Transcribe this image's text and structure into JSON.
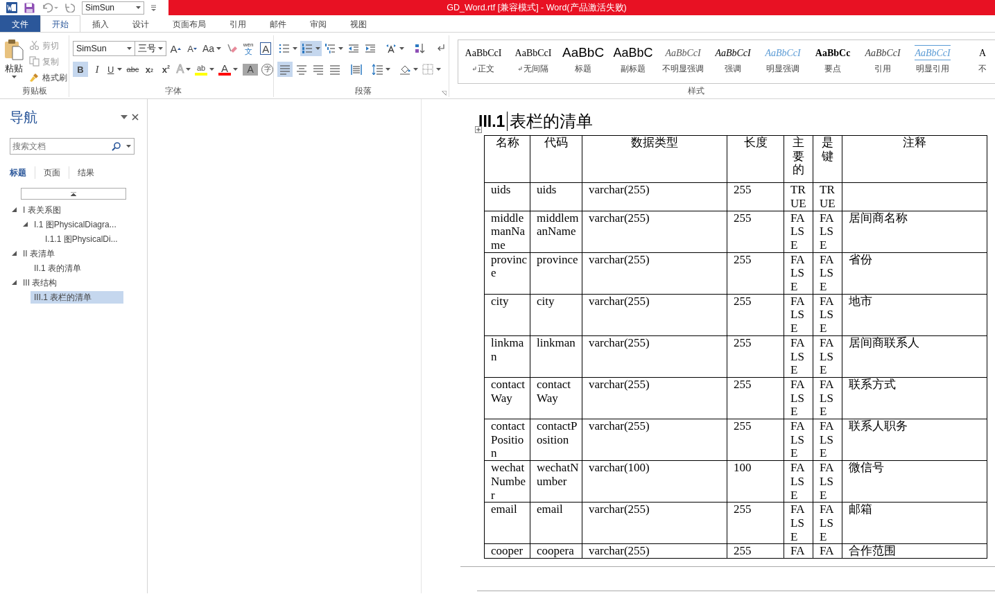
{
  "title_bar": {
    "font_box": "SimSun",
    "title": "GD_Word.rtf [兼容模式] - Word(产品激活失败)"
  },
  "tabs": [
    {
      "label": "文件",
      "kind": "file",
      "selected": false
    },
    {
      "label": "开始",
      "kind": "tab",
      "selected": true
    },
    {
      "label": "插入",
      "kind": "tab",
      "selected": false
    },
    {
      "label": "设计",
      "kind": "tab",
      "selected": false
    },
    {
      "label": "页面布局",
      "kind": "tab",
      "selected": false
    },
    {
      "label": "引用",
      "kind": "tab",
      "selected": false
    },
    {
      "label": "邮件",
      "kind": "tab",
      "selected": false
    },
    {
      "label": "审阅",
      "kind": "tab",
      "selected": false
    },
    {
      "label": "视图",
      "kind": "tab",
      "selected": false
    }
  ],
  "ribbon": {
    "clipboard": {
      "title": "剪贴板",
      "paste": "粘贴",
      "tools": [
        {
          "kind": "cut",
          "label": "剪切",
          "disabled": true
        },
        {
          "kind": "copy",
          "label": "复制",
          "disabled": true
        },
        {
          "kind": "painter",
          "label": "格式刷",
          "disabled": false
        }
      ]
    },
    "font": {
      "title": "字体",
      "name": "SimSun",
      "size": "三号",
      "row1": [
        {
          "kind": "grow",
          "label": "A"
        },
        {
          "kind": "shrink",
          "label": "A"
        },
        {
          "kind": "case",
          "label": "Aa"
        },
        {
          "kind": "clear"
        },
        {
          "kind": "pinyin",
          "label": "wén",
          "sub": "文"
        },
        {
          "kind": "border",
          "label": "A"
        }
      ],
      "row2": [
        {
          "kind": "bold",
          "label": "B",
          "selected": true
        },
        {
          "kind": "italic",
          "label": "I",
          "selected": false
        },
        {
          "kind": "underline",
          "label": "U",
          "selected": false
        },
        {
          "kind": "strike",
          "label": "abc",
          "selected": false
        },
        {
          "kind": "subscript",
          "label": "x",
          "sub": "2",
          "selected": false
        },
        {
          "kind": "superscript",
          "label": "x",
          "sub": "2",
          "selected": false
        },
        {
          "kind": "effects",
          "label": "A"
        },
        {
          "kind": "highlight",
          "label": "ab",
          "color": "#ffff00"
        },
        {
          "kind": "color",
          "label": "A",
          "color": "#ff0000"
        },
        {
          "kind": "shading",
          "label": "A"
        },
        {
          "kind": "enclose",
          "label": "字"
        }
      ]
    },
    "paragraph": {
      "title": "段落",
      "row1": [
        {
          "kind": "bullets",
          "selected": false
        },
        {
          "kind": "numbering",
          "selected": true
        },
        {
          "kind": "multilevel",
          "selected": false
        },
        {
          "kind": "outdent"
        },
        {
          "kind": "indent"
        },
        {
          "kind": "direction"
        },
        {
          "kind": "sort"
        },
        {
          "kind": "marks"
        }
      ],
      "row2": [
        {
          "kind": "left",
          "selected": true
        },
        {
          "kind": "center",
          "selected": false
        },
        {
          "kind": "right",
          "selected": false
        },
        {
          "kind": "justify",
          "selected": false
        },
        {
          "kind": "distribute",
          "selected": false
        },
        {
          "kind": "spacing"
        },
        {
          "kind": "fill"
        },
        {
          "kind": "borders"
        }
      ]
    },
    "styles": {
      "title": "样式",
      "items": [
        {
          "sample": "AaBbCcI",
          "name": "正文",
          "kind": "normal",
          "para_mark": true
        },
        {
          "sample": "AaBbCcI",
          "name": "无间隔",
          "kind": "normal",
          "para_mark": true
        },
        {
          "sample": "AaBbC",
          "name": "标题",
          "kind": "heading",
          "para_mark": false
        },
        {
          "sample": "AaBbC",
          "name": "副标题",
          "kind": "subheading",
          "para_mark": false
        },
        {
          "sample": "AaBbCcI",
          "name": "不明显强调",
          "kind": "subtle",
          "para_mark": false
        },
        {
          "sample": "AaBbCcI",
          "name": "强调",
          "kind": "emphasis",
          "para_mark": false
        },
        {
          "sample": "AaBbCcI",
          "name": "明显强调",
          "kind": "intense",
          "para_mark": false
        },
        {
          "sample": "AaBbCc",
          "name": "要点",
          "kind": "strong",
          "para_mark": false
        },
        {
          "sample": "AaBbCcI",
          "name": "引用",
          "kind": "quote",
          "para_mark": false
        },
        {
          "sample": "AaBbCcI",
          "name": "明显引用",
          "kind": "intense_quote",
          "para_mark": false
        },
        {
          "sample": "A",
          "name": "不",
          "kind": "normal",
          "para_mark": false
        }
      ]
    }
  },
  "nav": {
    "title": "导航",
    "search_placeholder": "搜索文档",
    "tabs": [
      {
        "label": "标题",
        "selected": true
      },
      {
        "label": "页面",
        "selected": false
      },
      {
        "label": "结果",
        "selected": false
      }
    ],
    "tree": [
      {
        "label": "I 表关系图",
        "expanded": true,
        "selected": false,
        "children": [
          {
            "label": "I.1 图PhysicalDiagra...",
            "expanded": true,
            "selected": false,
            "children": [
              {
                "label": "I.1.1 图PhysicalDi...",
                "selected": false
              }
            ]
          }
        ]
      },
      {
        "label": "II 表清单",
        "expanded": true,
        "selected": false,
        "children": [
          {
            "label": "II.1 表的清单",
            "selected": false
          }
        ]
      },
      {
        "label": "III 表结构",
        "expanded": true,
        "selected": false,
        "children": [
          {
            "label": "III.1 表栏的清单",
            "selected": true
          }
        ]
      }
    ]
  },
  "document": {
    "heading": {
      "number": "III.1",
      "text": "表栏的清单"
    },
    "table": {
      "columns": [
        "名称",
        "代码",
        "数据类型",
        "长度",
        "主要的",
        "是键",
        "注释"
      ],
      "rows": [
        {
          "name": "uids",
          "code": "uids",
          "data_type": "varchar(255)",
          "length": "255",
          "primary": "TRUE",
          "key": "TRUE"
        },
        {
          "name": "middlemanName",
          "code": "middlemanName",
          "data_type": "varchar(255)",
          "length": "255",
          "primary": "FALSE",
          "key": "FALSE",
          "comment": "居间商名称"
        },
        {
          "name": "province",
          "code": "province",
          "data_type": "varchar(255)",
          "length": "255",
          "primary": "FALSE",
          "key": "FALSE",
          "comment": "省份"
        },
        {
          "name": "city",
          "code": "city",
          "data_type": "varchar(255)",
          "length": "255",
          "primary": "FALSE",
          "key": "FALSE",
          "comment": "地市"
        },
        {
          "name": "linkman",
          "code": "linkman",
          "data_type": "varchar(255)",
          "length": "255",
          "primary": "FALSE",
          "key": "FALSE",
          "comment": "居间商联系人"
        },
        {
          "name": "contactWay",
          "code": "contactWay",
          "data_type": "varchar(255)",
          "length": "255",
          "primary": "FALSE",
          "key": "FALSE",
          "comment": "联系方式"
        },
        {
          "name": "contactPosition",
          "code": "contactPosition",
          "data_type": "varchar(255)",
          "length": "255",
          "primary": "FALSE",
          "key": "FALSE",
          "comment": "联系人职务"
        },
        {
          "name": "wechatNumber",
          "code": "wechatNumber",
          "data_type": "varchar(100)",
          "length": "100",
          "primary": "FALSE",
          "key": "FALSE",
          "comment": "微信号"
        },
        {
          "name": "email",
          "code": "email",
          "data_type": "varchar(255)",
          "length": "255",
          "primary": "FALSE",
          "key": "FALSE",
          "comment": "邮箱"
        },
        {
          "name": "cooper",
          "code": "coopera",
          "data_type": "varchar(255)",
          "length": "255",
          "primary": "FA",
          "key": "FA",
          "comment": "合作范围"
        }
      ]
    }
  }
}
